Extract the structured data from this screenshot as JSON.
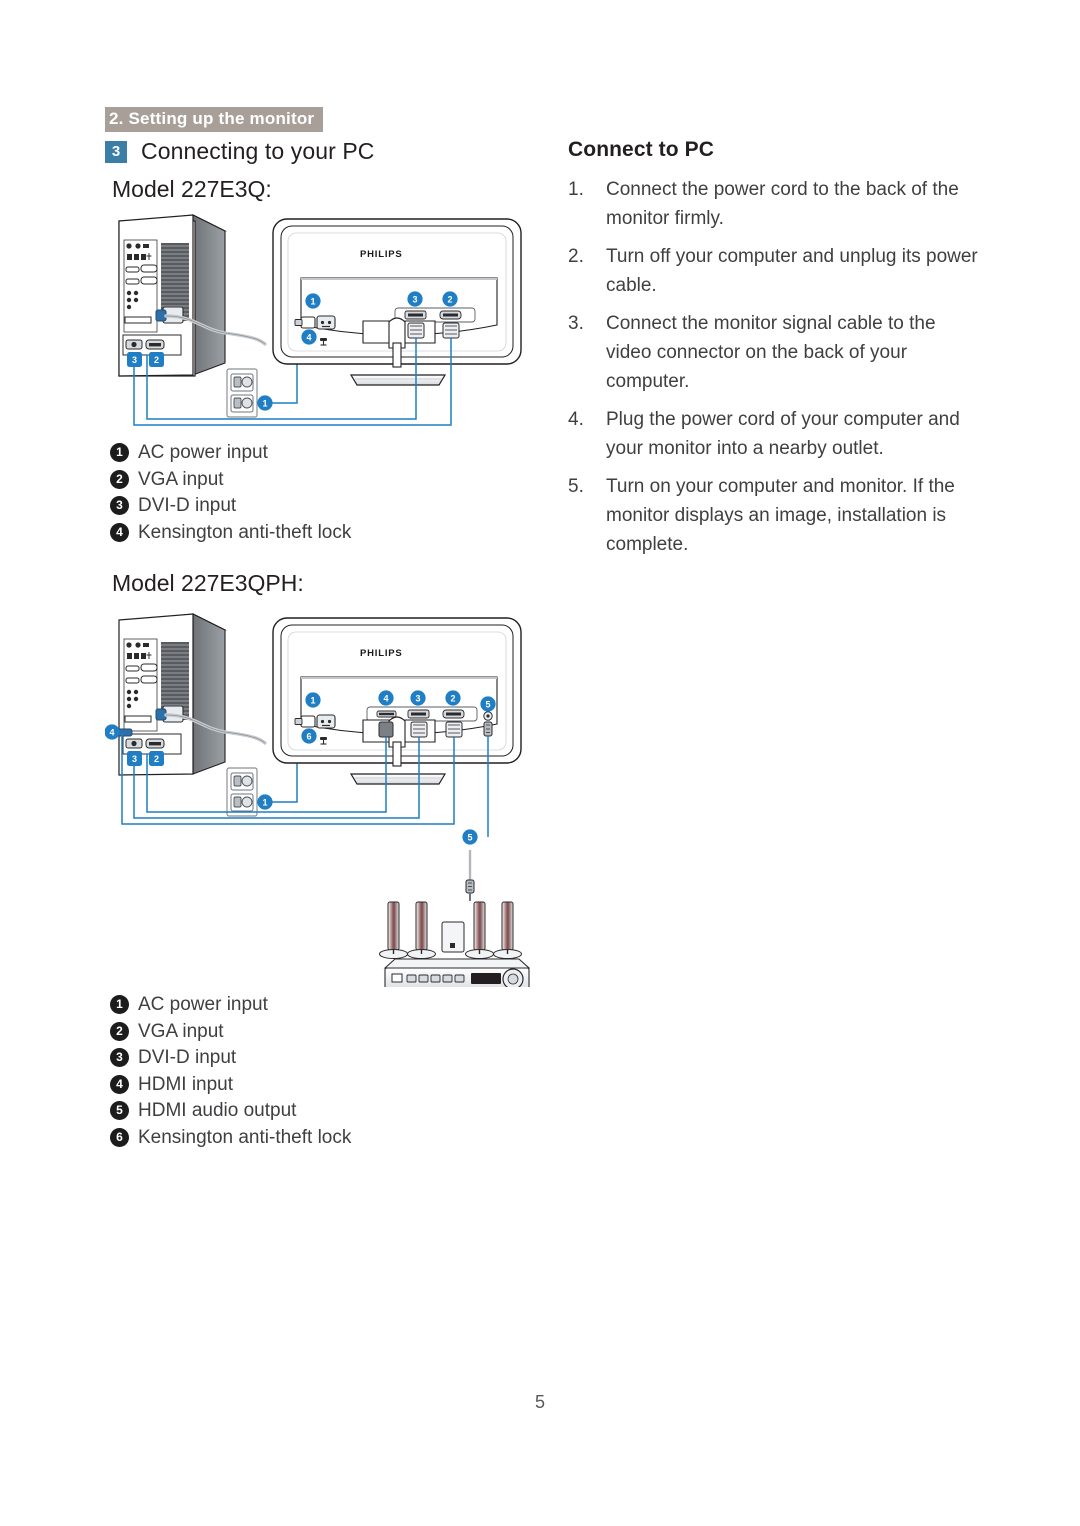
{
  "header": {
    "section_band": "2. Setting up the monitor",
    "subsection_number": "3",
    "subsection_title": "Connecting to your PC"
  },
  "models": {
    "model_1_label": "Model 227E3Q:",
    "model_2_label": "Model 227E3QPH:"
  },
  "brand": {
    "logo_text": "PHILIPS"
  },
  "right_column": {
    "title": "Connect to PC",
    "steps": [
      {
        "num": "1.",
        "text": "Connect the power cord to the back of the monitor firmly."
      },
      {
        "num": "2.",
        "text": "Turn off your computer and unplug its power cable."
      },
      {
        "num": "3.",
        "text": "Connect the monitor signal cable to the video connector on the back of your computer."
      },
      {
        "num": "4.",
        "text": "Plug the power cord of your computer and your monitor into a nearby outlet."
      },
      {
        "num": "5.",
        "text": "Turn on your computer and monitor. If the monitor displays an image,  installation is complete."
      }
    ]
  },
  "legend_model_1": [
    {
      "num": "1",
      "label": "AC power input"
    },
    {
      "num": "2",
      "label": "VGA input"
    },
    {
      "num": "3",
      "label": "DVI-D input"
    },
    {
      "num": "4",
      "label": "Kensington anti-theft lock"
    }
  ],
  "legend_model_2": [
    {
      "num": "1",
      "label": "AC power input"
    },
    {
      "num": "2",
      "label": "VGA input"
    },
    {
      "num": "3",
      "label": "DVI-D input"
    },
    {
      "num": "4",
      "label": "HDMI input"
    },
    {
      "num": "5",
      "label": "HDMI audio output"
    },
    {
      "num": "6",
      "label": "Kensington anti-theft lock"
    }
  ],
  "diagram_1_callouts": {
    "monitor_ac": "1",
    "monitor_kensington": "4",
    "monitor_dvi": "3",
    "monitor_vga": "2",
    "pc_dvi": "3",
    "pc_vga": "2",
    "wall_outlet": "1"
  },
  "diagram_2_callouts": {
    "monitor_ac": "1",
    "monitor_kensington": "6",
    "monitor_hdmi": "4",
    "monitor_dvi": "3",
    "monitor_vga": "2",
    "monitor_audio": "5",
    "pc_hdmi": "4",
    "pc_dvi": "3",
    "pc_vga": "2",
    "wall_outlet": "1",
    "audio_cable": "5"
  },
  "footer": {
    "page_number": "5"
  },
  "colors": {
    "band": "#a89f99",
    "badge_blue": "#3b7ea8",
    "callout_blue": "#1f7ec4",
    "bullet_black": "#1c1c1c",
    "text": "#3f3f42"
  }
}
